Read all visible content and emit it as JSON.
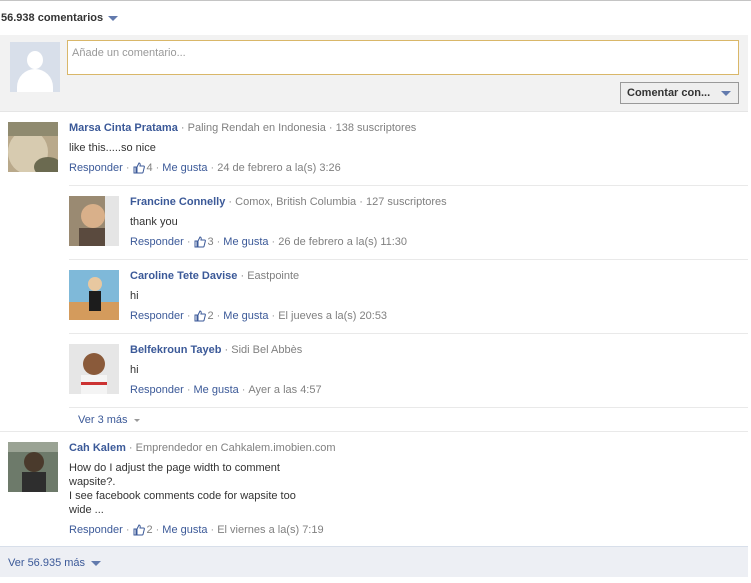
{
  "header": {
    "count_label": "56.938 comentarios"
  },
  "composer": {
    "placeholder": "Añade un comentario...",
    "post_button": "Comentar con..."
  },
  "actions": {
    "reply": "Responder",
    "like": "Me gusta"
  },
  "comments": [
    {
      "name": "Marsa Cinta Pratama",
      "meta": "Paling Rendah en Indonesia · 138 suscriptores",
      "text": [
        "like this.....so nice"
      ],
      "likes": "4",
      "time": "24 de febrero a la(s) 3:26"
    },
    {
      "name": "Francine Connelly",
      "meta": "Comox, British Columbia · 127 suscriptores",
      "text": [
        "thank you"
      ],
      "likes": "3",
      "time": "26 de febrero a la(s) 11:30"
    },
    {
      "name": "Caroline Tete Davise",
      "meta": "Eastpointe",
      "text": [
        "hi"
      ],
      "likes": "2",
      "time": "El jueves a la(s) 20:53"
    },
    {
      "name": "Belfekroun Tayeb",
      "meta": "Sidi Bel Abbès",
      "text": [
        "hi"
      ],
      "likes": "",
      "time": "Ayer a las 4:57"
    },
    {
      "name": "Cah Kalem",
      "meta": "Emprendedor en Cahkalem.imobien.com",
      "text": [
        "How do I adjust the page width to comment",
        "wapsite?.",
        "I see facebook comments code for wapsite too",
        "wide ..."
      ],
      "likes": "2",
      "time": "El viernes a la(s) 7:19"
    }
  ],
  "more_replies": "Ver 3 más",
  "footer": {
    "more_label": "Ver 56.935 más"
  },
  "colors": {
    "link": "#3b5998",
    "composer_bg": "#f2f2f2",
    "footer_bg": "#edeff4",
    "input_border": "#d9b769"
  }
}
